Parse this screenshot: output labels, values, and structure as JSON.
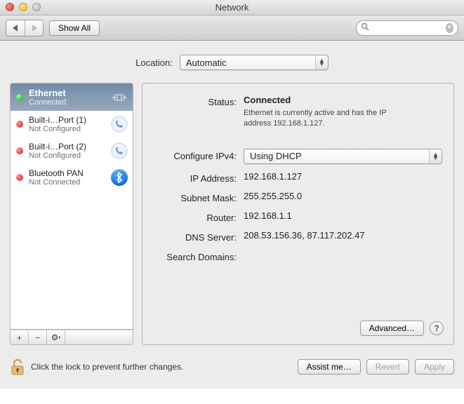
{
  "window": {
    "title": "Network"
  },
  "toolbar": {
    "show_all": "Show All",
    "search_placeholder": ""
  },
  "location": {
    "label": "Location:",
    "value": "Automatic"
  },
  "services": [
    {
      "name": "Ethernet",
      "status": "Connected",
      "state": "green",
      "icon": "ethernet",
      "selected": true
    },
    {
      "name": "Built-i…Port (1)",
      "status": "Not Configured",
      "state": "red",
      "icon": "serial",
      "selected": false
    },
    {
      "name": "Built-i…Port (2)",
      "status": "Not Configured",
      "state": "red",
      "icon": "serial",
      "selected": false
    },
    {
      "name": "Bluetooth PAN",
      "status": "Not Connected",
      "state": "red",
      "icon": "bluetooth",
      "selected": false
    }
  ],
  "detail": {
    "status_label": "Status:",
    "status_value": "Connected",
    "status_desc": "Ethernet is currently active and has the IP address 192.168.1.127.",
    "configure_label": "Configure IPv4:",
    "configure_value": "Using DHCP",
    "ip_label": "IP Address:",
    "ip_value": "192.168.1.127",
    "subnet_label": "Subnet Mask:",
    "subnet_value": "255.255.255.0",
    "router_label": "Router:",
    "router_value": "192.168.1.1",
    "dns_label": "DNS Server:",
    "dns_value": "208.53.156.36, 87.117.202.47",
    "searchdomains_label": "Search Domains:",
    "searchdomains_value": "",
    "advanced": "Advanced…"
  },
  "sidebar_buttons": {
    "add": "+",
    "remove": "−",
    "action": "✻"
  },
  "footer": {
    "lock_msg": "Click the lock to prevent further changes.",
    "assist": "Assist me…",
    "revert": "Revert",
    "apply": "Apply"
  }
}
